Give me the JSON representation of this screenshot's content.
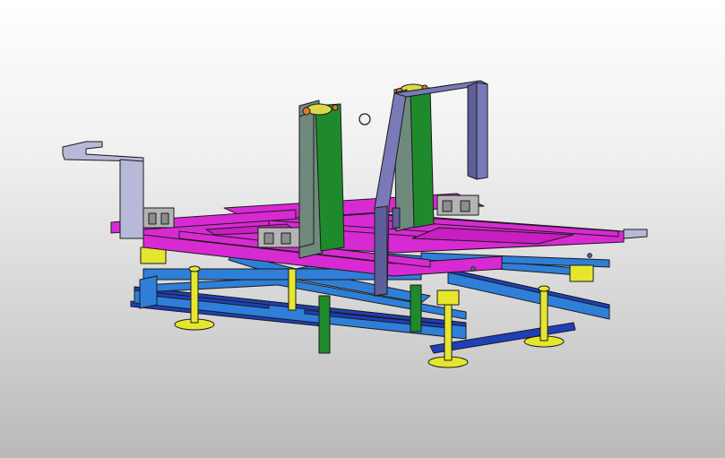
{
  "viewport": {
    "background_top": "#ffffff",
    "background_bottom": "#b9b9b9",
    "cursor": "circle-cursor-icon"
  },
  "model": {
    "colors": {
      "platform": "#d82ad3",
      "base_frame": "#2f7fd8",
      "base_frame_dark": "#1f3fb8",
      "column": "#6f8a7c",
      "column_core": "#1f8a2c",
      "pivot_pins": "#d9d94a",
      "handle": "#7a7ab8",
      "left_bracket": "#b8b8d8",
      "leveling_feet": "#e6e62e",
      "clamps": "#b4b4b4",
      "outline": "#1b1b1b"
    }
  }
}
